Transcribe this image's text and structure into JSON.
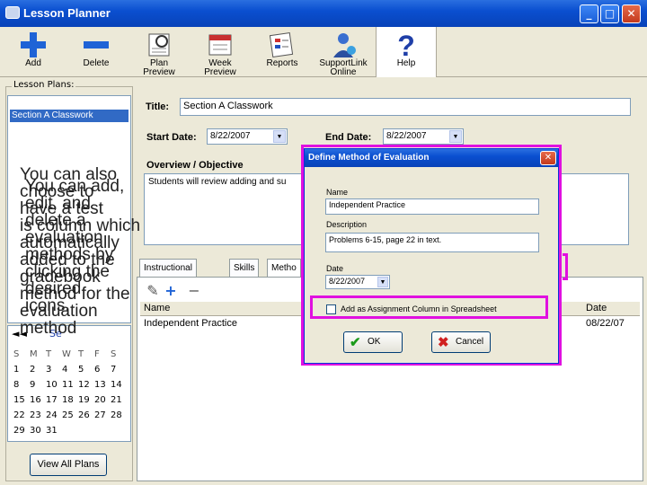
{
  "window": {
    "title": "Lesson Planner",
    "minimize_glyph": "_",
    "maximize_glyph": "□",
    "close_glyph": "✕"
  },
  "toolbar": [
    {
      "label": "Add",
      "icon": "add-icon"
    },
    {
      "label": "Delete",
      "icon": "delete-icon"
    },
    {
      "label": "Plan\nPreview",
      "icon": "plan-preview-icon"
    },
    {
      "label": "Week\nPreview",
      "icon": "week-preview-icon"
    },
    {
      "label": "Reports",
      "icon": "reports-icon"
    },
    {
      "label": "SupportLink\nOnline",
      "icon": "support-icon"
    },
    {
      "label": "Help",
      "icon": "help-icon"
    }
  ],
  "lesson_plans": {
    "legend": "Lesson Plans:",
    "selected": "Section A Classwork"
  },
  "calendar": {
    "prev": "◄◄",
    "month_fragment": "Se",
    "weekdays": [
      "S",
      "M",
      "T",
      "W",
      "T",
      "F",
      "S"
    ],
    "rows": [
      [
        "1",
        "2",
        "3",
        "4",
        "5",
        "6",
        "7"
      ],
      [
        "8",
        "9",
        "10",
        "11",
        "12",
        "13",
        "14"
      ],
      [
        "15",
        "16",
        "17",
        "18",
        "19",
        "20",
        "21"
      ],
      [
        "22",
        "23",
        "24",
        "25",
        "26",
        "27",
        "28"
      ],
      [
        "29",
        "30",
        "31",
        "",
        "",
        "",
        ""
      ]
    ]
  },
  "view_all_label": "View All Plans",
  "plan": {
    "title_label": "Title:",
    "title_value": "Section A Classwork",
    "start_label": "Start Date:",
    "start_value": "8/22/2007",
    "end_label": "End Date:",
    "end_value": "8/22/2007",
    "overview_label": "Overview / Objective",
    "overview_text": "Students will review adding and su"
  },
  "tabs": [
    "Instructional Plans",
    "Skills",
    "Metho"
  ],
  "methods_grid": {
    "columns": [
      "Name",
      "Date"
    ],
    "rows": [
      {
        "name": "Independent Practice",
        "date": "08/22/07"
      }
    ]
  },
  "dialog": {
    "title": "Define Method of Evaluation",
    "name_label": "Name",
    "name_value": "Independent Practice",
    "description_label": "Description",
    "description_value": "Problems 6-15, page 22 in text.",
    "date_label": "Date",
    "date_value": "8/22/2007",
    "checkbox_label": "Add as Assignment Column in Spreadsheet",
    "ok_label": "OK",
    "cancel_label": "Cancel"
  },
  "overlay_texts": [
    "You can also\nchoose to\nhave a test\nis column which\nautomatically\nadded to the\ngradebook\nmethod for the\nevaluation\nmethod",
    "You can add,\nedit, and\ndelete a\nevaluation\nmethods by\nclicking the\ndesired\nicons."
  ],
  "colors": {
    "highlight": "#e010e0",
    "selection": "#316ac5",
    "titlebar": "#0a4fd0"
  }
}
